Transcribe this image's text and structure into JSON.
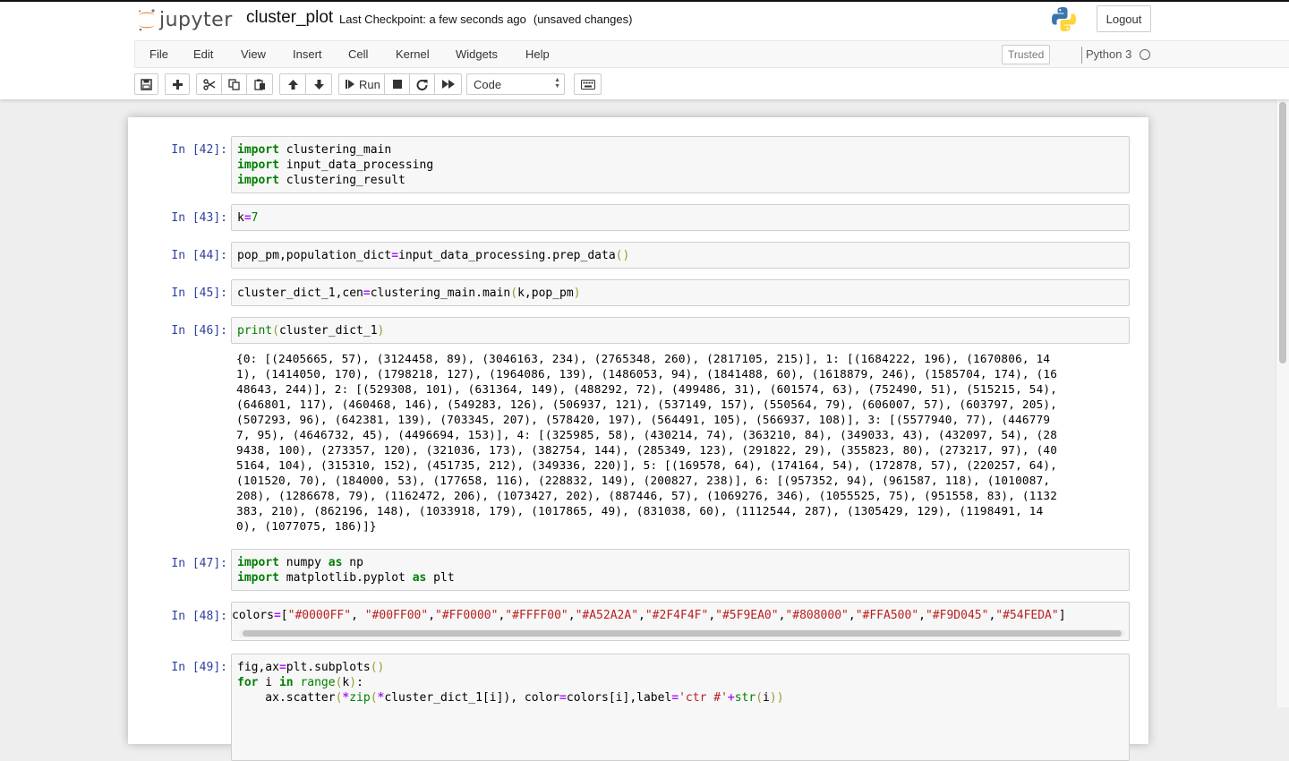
{
  "header": {
    "logo_text": "jupyter",
    "notebook_name": "cluster_plot",
    "checkpoint": "Last Checkpoint: a few seconds ago",
    "autosave": "(unsaved changes)",
    "logout_label": "Logout"
  },
  "menu": {
    "items": [
      "File",
      "Edit",
      "View",
      "Insert",
      "Cell",
      "Kernel",
      "Widgets",
      "Help"
    ],
    "trusted": "Trusted",
    "kernel": "Python 3"
  },
  "toolbar": {
    "run_label": "Run",
    "cell_type": "Code"
  },
  "cells": {
    "c42": {
      "prompt": "In [42]:"
    },
    "c43": {
      "prompt": "In [43]:"
    },
    "c44": {
      "prompt": "In [44]:"
    },
    "c45": {
      "prompt": "In [45]:"
    },
    "c46": {
      "prompt": "In [46]:",
      "output": [
        "{0: [(2405665, 57), (3124458, 89), (3046163, 234), (2765348, 260), (2817105, 215)], 1: [(1684222, 196), (1670806, 14",
        "1), (1414050, 170), (1798218, 127), (1964086, 139), (1486053, 94), (1841488, 60), (1618879, 246), (1585704, 174), (16",
        "48643, 244)], 2: [(529308, 101), (631364, 149), (488292, 72), (499486, 31), (601574, 63), (752490, 51), (515215, 54),",
        "(646801, 117), (460468, 146), (549283, 126), (506937, 121), (537149, 157), (550564, 79), (606007, 57), (603797, 205),",
        "(507293, 96), (642381, 139), (703345, 207), (578420, 197), (564491, 105), (566937, 108)], 3: [(5577940, 77), (446779",
        "7, 95), (4646732, 45), (4496694, 153)], 4: [(325985, 58), (430214, 74), (363210, 84), (349033, 43), (432097, 54), (28",
        "9438, 100), (273357, 120), (321036, 173), (382754, 144), (285349, 123), (291822, 29), (355823, 80), (273217, 97), (40",
        "5164, 104), (315310, 152), (451735, 212), (349336, 220)], 5: [(169578, 64), (174164, 54), (172878, 57), (220257, 64),",
        "(101520, 70), (184000, 53), (177658, 116), (228832, 149), (200827, 238)], 6: [(957352, 94), (961587, 118), (1010087,",
        "208), (1286678, 79), (1162472, 206), (1073427, 202), (887446, 57), (1069276, 346), (1055525, 75), (951558, 83), (1132",
        "383, 210), (862196, 148), (1033918, 179), (1017865, 49), (831038, 60), (1112544, 287), (1305429, 129), (1198491, 14",
        "0), (1077075, 186)]}"
      ]
    },
    "c47": {
      "prompt": "In [47]:"
    },
    "c48": {
      "prompt": "In [48]:"
    },
    "c49": {
      "prompt": "In [49]:"
    }
  },
  "code": {
    "t_import": "import",
    "t_as": "as",
    "t_for": "for",
    "t_in": "in",
    "t_eq": "=",
    "t_plus": "+",
    "t_star": "*",
    "t_lp": "(",
    "t_rp": ")",
    "t_lpp": "()",
    "t_range": "range",
    "t_zip": "zip",
    "t_str": "str",
    "t_print": "print",
    "c42_m1": " clustering_main",
    "c42_m2": " input_data_processing",
    "c42_m3": " clustering_result",
    "c43_a": "k",
    "c43_b": "7",
    "c44_a": "pop_pm,population_dict",
    "c44_b": "input_data_processing.prep_data",
    "c45_a": "cluster_dict_1,cen",
    "c45_b": "clustering_main.main",
    "c45_c": "k,pop_pm",
    "c46_a": "cluster_dict_1",
    "c47_a": " numpy ",
    "c47_b": " np",
    "c47_c": " matplotlib.pyplot ",
    "c47_d": " plt",
    "c48_a": "colors",
    "c48_b": "[",
    "c48_c": "\"#0000FF\"",
    "c48_d": ", ",
    "c48_e": "\"#00FF00\"",
    "c48_f": ",",
    "c48_g": "\"#FF0000\"",
    "c48_h": "\"#FFFF00\"",
    "c48_i": "\"#A52A2A\"",
    "c48_j": "\"#2F4F4F\"",
    "c48_k": "\"#5F9EA0\"",
    "c48_l": "\"#808000\"",
    "c48_m": "\"#FFA500\"",
    "c48_n": "\"#F9D045\"",
    "c48_o": "\"#54FEDA\"",
    "c48_p": "]",
    "c49_a": "fig,ax",
    "c49_b": "plt.subplots",
    "c49_c": " i ",
    "c49_d": " ",
    "c49_e": "k",
    "c49_f": ":",
    "c49_g": "    ax.scatter",
    "c49_h": "cluster_dict_1[i]), color",
    "c49_i": "colors[i],label",
    "c49_j": "'ctr #'",
    "c49_k": "i",
    "c49_l": "))"
  },
  "colors": {
    "prompt": "#303f9f",
    "keyword": "#008000",
    "operator": "#aa22ff",
    "string": "#ba2121",
    "paren": "#999933"
  }
}
